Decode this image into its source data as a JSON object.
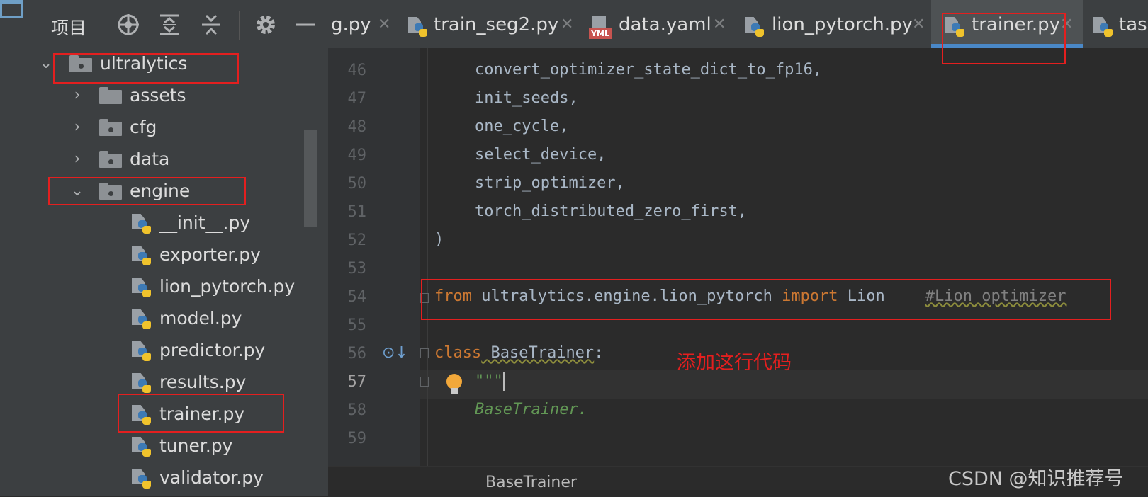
{
  "panel": {
    "title": "项目",
    "tree": [
      {
        "label": "ultralytics",
        "kind": "folder",
        "expanded": true
      },
      {
        "label": "assets",
        "kind": "folder",
        "expanded": false
      },
      {
        "label": "cfg",
        "kind": "folder",
        "expanded": false
      },
      {
        "label": "data",
        "kind": "folder",
        "expanded": false
      },
      {
        "label": "engine",
        "kind": "folder",
        "expanded": true
      },
      {
        "label": "__init__.py",
        "kind": "file"
      },
      {
        "label": "exporter.py",
        "kind": "file"
      },
      {
        "label": "lion_pytorch.py",
        "kind": "file"
      },
      {
        "label": "model.py",
        "kind": "file"
      },
      {
        "label": "predictor.py",
        "kind": "file"
      },
      {
        "label": "results.py",
        "kind": "file"
      },
      {
        "label": "trainer.py",
        "kind": "file"
      },
      {
        "label": "tuner.py",
        "kind": "file"
      },
      {
        "label": "validator.py",
        "kind": "file"
      }
    ]
  },
  "tabs": [
    {
      "label": "g.py"
    },
    {
      "label": "train_seg2.py"
    },
    {
      "label": "data.yaml"
    },
    {
      "label": "lion_pytorch.py"
    },
    {
      "label": "trainer.py",
      "active": true
    },
    {
      "label": "task"
    }
  ],
  "editor": {
    "lines": [
      {
        "num": "46",
        "code": "convert_optimizer_state_dict_to_fp16,"
      },
      {
        "num": "47",
        "code": "init_seeds,"
      },
      {
        "num": "48",
        "code": "one_cycle,"
      },
      {
        "num": "49",
        "code": "select_device,"
      },
      {
        "num": "50",
        "code": "strip_optimizer,"
      },
      {
        "num": "51",
        "code": "torch_distributed_zero_first,"
      },
      {
        "num": "52",
        "code": ")"
      },
      {
        "num": "53",
        "code": ""
      },
      {
        "num": "54",
        "from_kw": "from",
        "module": " ultralytics.engine.lion_pytorch ",
        "import_kw": "import",
        "name": " Lion",
        "comment": "#Lion optimizer"
      },
      {
        "num": "55",
        "code": ""
      },
      {
        "num": "56",
        "class_kw": "class",
        "class_name": " BaseTrainer",
        "colon": ":"
      },
      {
        "num": "57",
        "doc": "\"\"\""
      },
      {
        "num": "58",
        "doc": "BaseTrainer."
      },
      {
        "num": "59",
        "code": ""
      }
    ]
  },
  "breadcrumb": "BaseTrainer",
  "annotation": "添加这行代码",
  "watermark": "CSDN @知识推荐号"
}
